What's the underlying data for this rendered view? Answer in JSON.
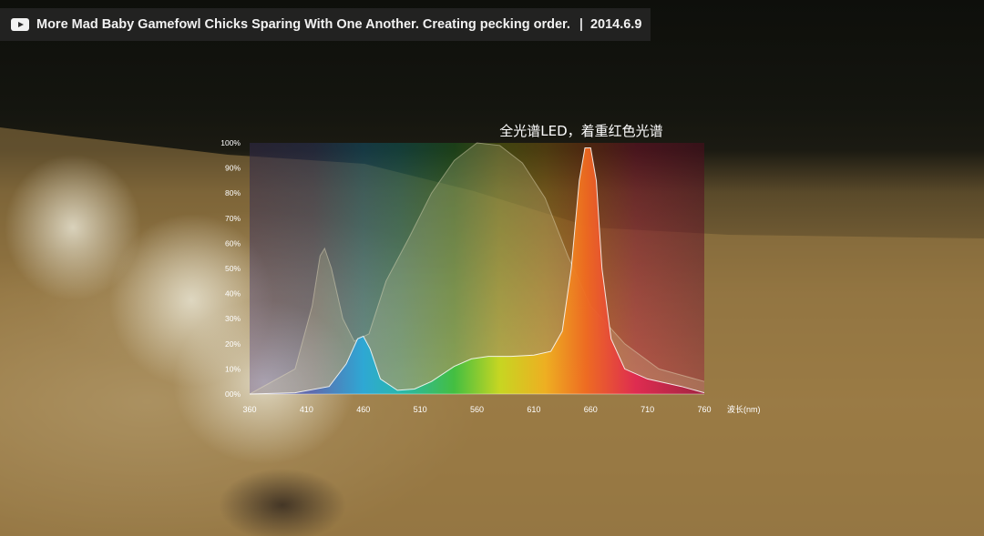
{
  "video": {
    "title": "More Mad Baby Gamefowl Chicks Sparing With One Another. Creating pecking order.",
    "date": "2014.6.9",
    "separator": "|",
    "icon": "youtube-play-icon"
  },
  "chart_data": {
    "type": "area",
    "title": "全光谱LED，着重红色光谱",
    "xlabel": "波长(nm)",
    "ylabel": "",
    "xlim": [
      360,
      760
    ],
    "ylim": [
      0,
      100
    ],
    "x_ticks": [
      "360",
      "410",
      "460",
      "510",
      "560",
      "610",
      "660",
      "710",
      "760"
    ],
    "y_ticks": [
      "00%",
      "10%",
      "20%",
      "30%",
      "40%",
      "50%",
      "60%",
      "70%",
      "80%",
      "90%",
      "100%"
    ],
    "grid": false,
    "background": "visible spectrum gradient",
    "series": [
      {
        "points": [
          [
            360,
            0
          ],
          [
            400,
            0.5
          ],
          [
            430,
            3
          ],
          [
            445,
            12
          ],
          [
            455,
            22
          ],
          [
            460,
            23
          ],
          [
            466,
            18
          ],
          [
            475,
            6
          ],
          [
            490,
            1.5
          ],
          [
            505,
            2
          ],
          [
            520,
            5
          ],
          [
            540,
            11
          ],
          [
            555,
            14
          ],
          [
            570,
            15
          ],
          [
            590,
            15
          ],
          [
            610,
            15.5
          ],
          [
            625,
            17
          ],
          [
            635,
            25
          ],
          [
            643,
            50
          ],
          [
            650,
            85
          ],
          [
            655,
            98
          ],
          [
            660,
            98
          ],
          [
            665,
            85
          ],
          [
            670,
            50
          ],
          [
            678,
            22
          ],
          [
            690,
            10
          ],
          [
            710,
            6
          ],
          [
            740,
            3
          ],
          [
            760,
            0.5
          ]
        ]
      },
      {
        "points": [
          [
            360,
            0
          ],
          [
            400,
            10
          ],
          [
            415,
            35
          ],
          [
            422,
            55
          ],
          [
            426,
            58
          ],
          [
            432,
            50
          ],
          [
            442,
            30
          ],
          [
            452,
            21
          ],
          [
            465,
            24
          ],
          [
            480,
            45
          ],
          [
            500,
            62
          ],
          [
            520,
            80
          ],
          [
            540,
            93
          ],
          [
            560,
            100
          ],
          [
            580,
            99
          ],
          [
            600,
            92
          ],
          [
            620,
            78
          ],
          [
            640,
            55
          ],
          [
            660,
            35
          ],
          [
            690,
            20
          ],
          [
            720,
            10
          ],
          [
            760,
            5
          ]
        ]
      }
    ]
  }
}
